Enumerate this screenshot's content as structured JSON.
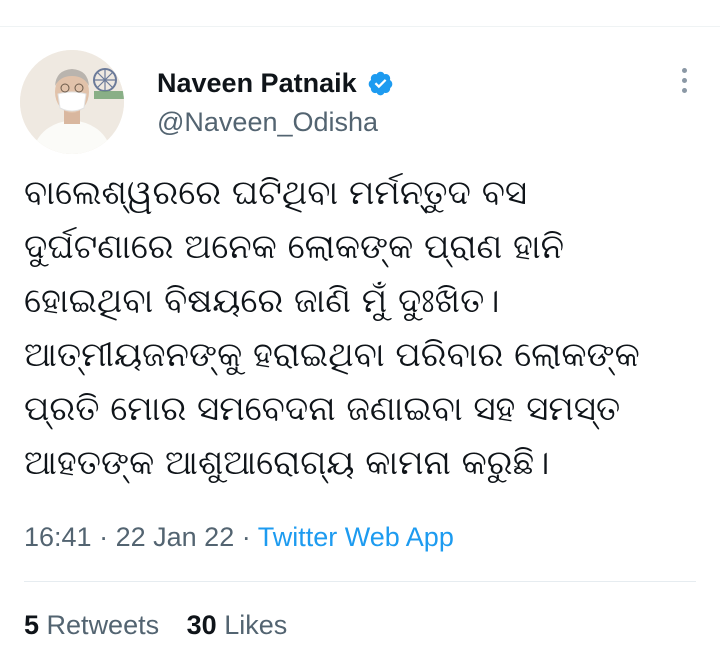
{
  "author": {
    "name": "Naveen Patnaik",
    "handle": "@Naveen_Odisha",
    "verified_icon": "verified-badge-icon"
  },
  "tweet": {
    "text": "ବାଲେଶ୍ୱରରେ ଘଟିଥିବା ମର୍ମନ୍ତୁଦ ବସ\nଦୁର୍ଘଟଣାରେ ଅନେକ ଲୋକଙ୍କ ପ୍ରାଣ ହାନି\nହୋଇଥିବା ବିଷୟରେ ଜାଣି ମୁଁ ଦୁଃଖିତ।\nଆତ୍ମୀୟଜନଙ୍କୁ ହରାଇଥିବା ପରିବାର ଲୋକଙ୍କ\nପ୍ରତି ମୋର ସମବେଦନା ଜଣାଇବା ସହ ସମସ୍ତ\nଆହତଙ୍କ ଆଶୁଆରୋଗ୍ୟ କାମନା କରୁଛି।",
    "time": "16:41",
    "separator": "·",
    "date": "22 Jan 22",
    "source": "Twitter Web App"
  },
  "stats": {
    "retweets_count": "5",
    "retweets_label": "Retweets",
    "likes_count": "30",
    "likes_label": "Likes"
  },
  "colors": {
    "link": "#1d9bf0",
    "secondary_text": "#536471",
    "primary_text": "#0f1419"
  }
}
